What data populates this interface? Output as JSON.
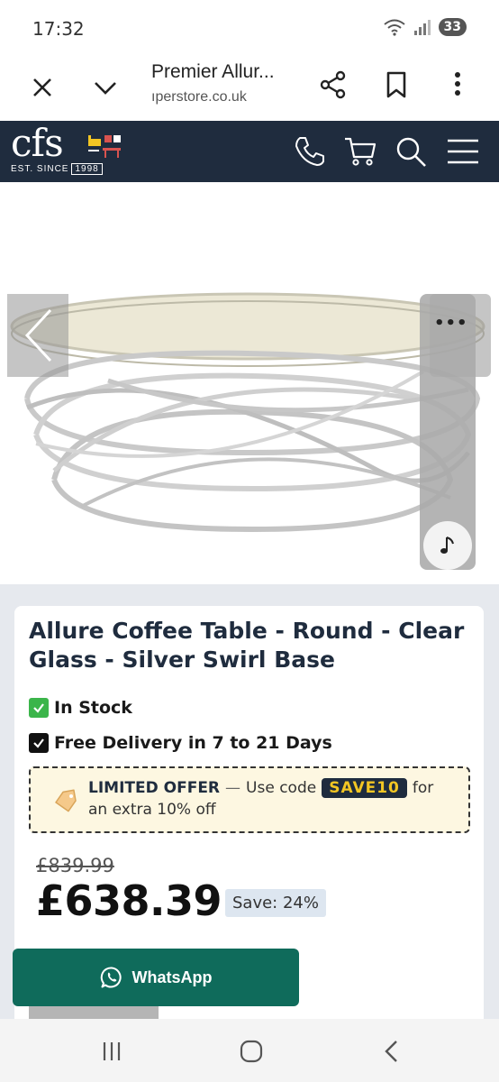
{
  "status_bar": {
    "time": "17:32",
    "battery": "33",
    "wifi_icon": "wifi-icon",
    "signal_icon": "signal-icon"
  },
  "browser": {
    "title": "Premier Allur...",
    "url": "ıperstore.co.uk",
    "icons": [
      "close-icon",
      "chevron-down-icon",
      "share-icon",
      "bookmark-icon",
      "more-vertical-icon"
    ]
  },
  "site_header": {
    "logo_text": "cfs",
    "logo_est": "EST. SINCE",
    "logo_year": "1998",
    "icons": [
      "phone-icon",
      "cart-icon",
      "search-icon",
      "menu-icon"
    ],
    "background": "#1f2c3e"
  },
  "gallery": {
    "panel_dots": "•••",
    "icons": [
      "chevron-left-icon",
      "music-note-icon"
    ]
  },
  "product": {
    "title": "Allure Coffee Table - Round - Clear Glass - Silver Swirl Base",
    "stock": "In Stock",
    "delivery": "Free Delivery in 7 to 21 Days",
    "offer": {
      "label": "LIMITED OFFER",
      "dash": "—",
      "use_code": "Use code",
      "code": "SAVE10",
      "for": "for",
      "line2": "an extra 10% off"
    },
    "old_price": "£839.99",
    "price": "£638.39",
    "save": "Save: 24%"
  },
  "whatsapp": {
    "label": "WhatsApp",
    "color": "#0f6b5b"
  },
  "nav_bar": {
    "icons": [
      "recent-apps-icon",
      "home-icon",
      "back-icon"
    ]
  }
}
